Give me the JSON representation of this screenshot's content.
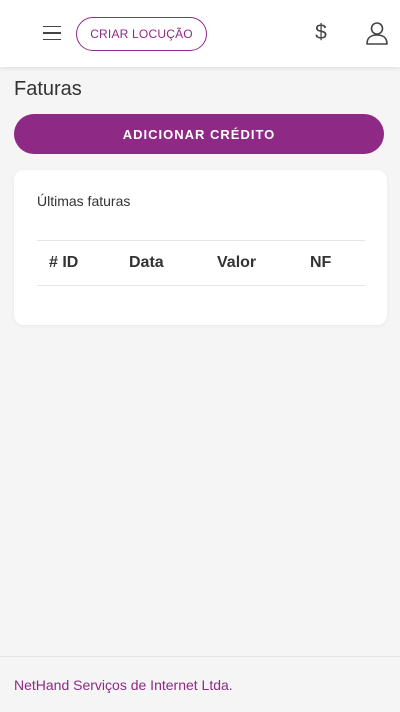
{
  "header": {
    "create_button_label": "CRIAR LOCUÇÃO",
    "dollar_symbol": "$",
    "menu_icon": "hamburger-menu-icon",
    "billing_icon": "dollar-icon",
    "user_icon": "user-icon"
  },
  "main": {
    "title": "Faturas",
    "add_credit_label": "ADICIONAR CRÉDITO",
    "invoices_card": {
      "title": "Últimas faturas",
      "columns": [
        "# ID",
        "Data",
        "Valor",
        "NF"
      ],
      "rows": []
    }
  },
  "footer": {
    "company": "NetHand Serviços de Internet Ltda."
  },
  "colors": {
    "accent": "#8e2a86",
    "background": "#f5f5f5",
    "card": "#ffffff"
  }
}
